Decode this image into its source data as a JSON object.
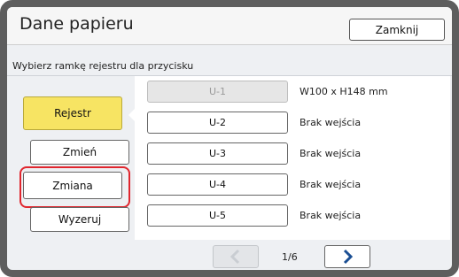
{
  "header": {
    "title": "Dane papieru",
    "close_label": "Zamknij"
  },
  "instruction": "Wybierz ramkę rejestru dla przycisku",
  "left_buttons": [
    {
      "label": "Rejestr",
      "active": true
    },
    {
      "label": "Zmień"
    },
    {
      "label": "Zmiana",
      "highlighted": true
    },
    {
      "label": "Wyzeruj"
    }
  ],
  "registrations": [
    {
      "label": "U-1",
      "status": "W100 x H148 mm",
      "disabled": true
    },
    {
      "label": "U-2",
      "status": "Brak wejścia"
    },
    {
      "label": "U-3",
      "status": "Brak wejścia"
    },
    {
      "label": "U-4",
      "status": "Brak wejścia"
    },
    {
      "label": "U-5",
      "status": "Brak wejścia"
    }
  ],
  "pagination": {
    "indicator": "1/6",
    "prev_icon": "chevron-left-icon",
    "next_icon": "chevron-right-icon"
  },
  "colors": {
    "active": "#f7e463",
    "highlight": "#e0262e",
    "frame": "#5e5e5e",
    "arrow": "#1a4e93"
  }
}
